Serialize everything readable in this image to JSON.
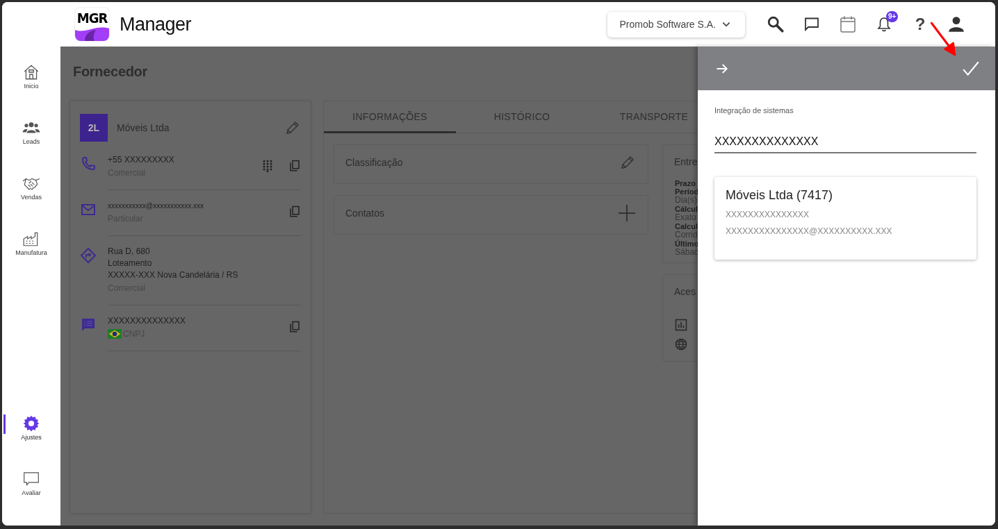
{
  "header": {
    "logo": "MGR",
    "app_name": "Manager",
    "company_selector": "Promob Software S.A.",
    "notification_badge": "9+",
    "help": "?"
  },
  "sidebar": {
    "items": [
      {
        "label": "Inicio",
        "selected": false
      },
      {
        "label": "Leads",
        "selected": false
      },
      {
        "label": "Vendas",
        "selected": false
      },
      {
        "label": "Manufatura",
        "selected": false
      },
      {
        "label": "Ajustes",
        "selected": true
      },
      {
        "label": "Avaliar",
        "selected": false
      }
    ]
  },
  "page": {
    "title": "Fornecedor"
  },
  "supplier": {
    "avatar": "2L",
    "name": "Móveis Ltda",
    "contacts": [
      {
        "kind": "phone",
        "lines": [
          "+55 XXXXXXXXX"
        ],
        "caption": "Comercial"
      },
      {
        "kind": "email",
        "lines": [
          "xxxxxxxxxxx@xxxxxxxxxxx.xxx"
        ],
        "caption": "Particular"
      },
      {
        "kind": "address",
        "lines": [
          "Rua D, 680",
          "Loteamento",
          "XXXXX-XXX Nova Candelária / RS"
        ],
        "caption": "Comercial"
      },
      {
        "kind": "document",
        "lines": [
          "XXXXXXXXXXXXXX"
        ],
        "caption": "CNPJ"
      }
    ]
  },
  "tabs": [
    {
      "label": "INFORMAÇÕES",
      "selected": true
    },
    {
      "label": "HISTÓRICO",
      "selected": false
    },
    {
      "label": "TRANSPORTE",
      "selected": false
    }
  ],
  "sections": [
    {
      "title": "Classificação",
      "kind": "edit"
    },
    {
      "title": "Contatos",
      "kind": "add"
    }
  ],
  "side_cards": [
    {
      "title": "Entre",
      "rows": [
        {
          "kind": "label",
          "text": "Prazo"
        },
        {
          "kind": "label",
          "text": "Períod"
        },
        {
          "kind": "value",
          "text": "Dia(s)"
        },
        {
          "kind": "label",
          "text": "Cálcul"
        },
        {
          "kind": "value",
          "text": "Exato"
        },
        {
          "kind": "label",
          "text": "Calcul"
        },
        {
          "kind": "value",
          "text": "Corrid"
        },
        {
          "kind": "label",
          "text": "Último"
        },
        {
          "kind": "value",
          "text": "Sábad"
        }
      ]
    },
    {
      "title": "Aces",
      "rows": [
        {
          "kind": "chart"
        },
        {
          "kind": "globe"
        }
      ]
    }
  ],
  "drawer": {
    "field_label": "Integração de sistemas",
    "field_value": "XXXXXXXXXXXXXX",
    "result": {
      "title": "Móveis Ltda (7417)",
      "lines": [
        "XXXXXXXXXXXXXXX",
        "XXXXXXXXXXXXXXX@XXXXXXXXXX.XXX"
      ]
    }
  }
}
